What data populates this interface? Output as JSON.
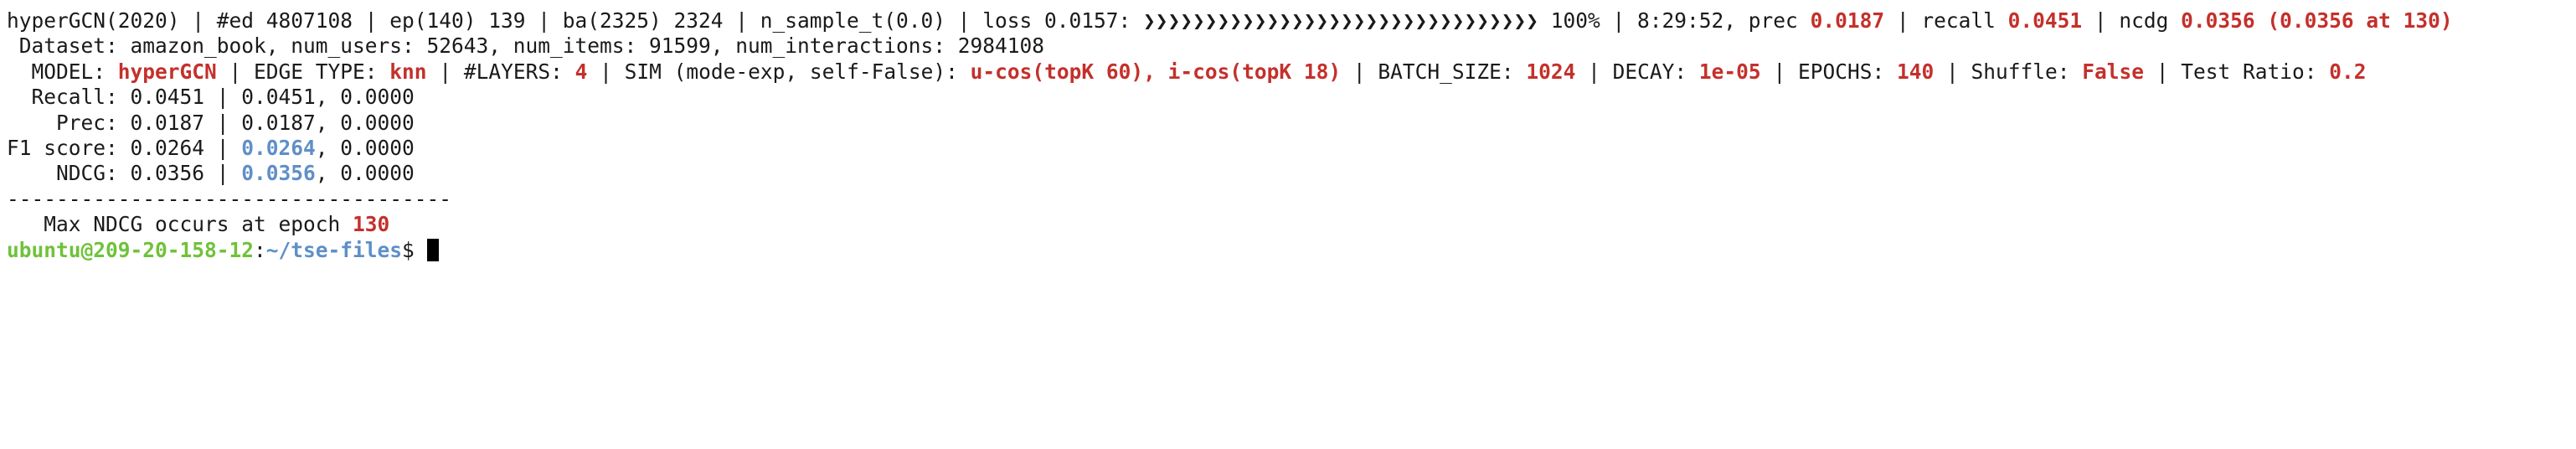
{
  "colors": {
    "background": "#ffffff",
    "text": "#1a1a1a",
    "highlight_red": "#c4302b",
    "highlight_blue": "#5f8fc7",
    "prompt_user_green": "#6fc23a",
    "prompt_path_blue": "#5f8fc7",
    "cursor": "#000000"
  },
  "progress": {
    "prefix": "hyperGCN(2020) | #ed 4807108 | ep(140) 139 | ba(2325) 2324 | n_sample_t(0.0) | loss 0.0157: ",
    "bar": "❯❯❯❯❯❯❯❯❯❯❯❯❯❯❯❯❯❯❯❯❯❯❯❯❯❯❯❯❯❯❯❯",
    "mid": " 100% | 8:29:52, prec ",
    "prec": "0.0187",
    "sep1": " | recall ",
    "recall": "0.0451",
    "sep2": " | ncdg ",
    "ncdg": "0.0356 (0.0356 at 130)"
  },
  "dataset_line": " Dataset: amazon_book, num_users: 52643, num_items: 91599, num_interactions: 2984108",
  "config": {
    "model_label": "  MODEL: ",
    "model": "hyperGCN",
    "edge_label": " | EDGE TYPE: ",
    "edge": "knn",
    "layers_label": " | #LAYERS: ",
    "layers": "4",
    "sim_label": " | SIM (mode-exp, self-False): ",
    "sim": "u-cos(topK 60), i-cos(topK 18)",
    "batch_label": " | BATCH_SIZE: ",
    "batch": "1024",
    "decay_label": " | DECAY: ",
    "decay": "1e-05",
    "epochs_label": " | EPOCHS: ",
    "epochs": "140",
    "shuffle_label": " | Shuffle: ",
    "shuffle": "False",
    "ratio_label": " | Test Ratio: ",
    "ratio": "0.2"
  },
  "metrics": {
    "recall": {
      "label": "  Recall: 0.0451 | ",
      "best": "0.0451",
      "rest": ", 0.0000"
    },
    "prec": {
      "label": "    Prec: 0.0187 | ",
      "best": "0.0187",
      "rest": ", 0.0000"
    },
    "f1": {
      "label": "F1 score: 0.0264 | ",
      "best": "0.0264",
      "rest": ", 0.0000"
    },
    "ndcg": {
      "label": "    NDCG: 0.0356 | ",
      "best": "0.0356",
      "rest": ", 0.0000"
    }
  },
  "divider": "------------------------------------",
  "max_ndcg": {
    "label": "   Max NDCG occurs at epoch ",
    "epoch": "130"
  },
  "prompt": {
    "user_host": "ubuntu@209-20-158-12",
    "colon": ":",
    "path": "~/tse-files",
    "symbol": "$ "
  }
}
